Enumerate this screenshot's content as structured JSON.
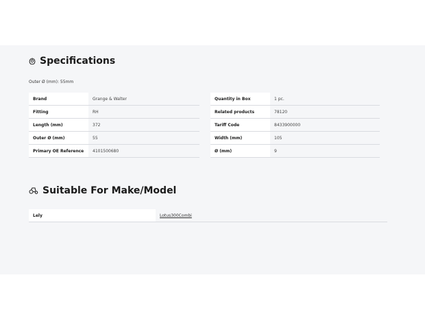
{
  "specifications": {
    "title": "Specifications",
    "subline": "Outer Ø (mm): 55mm",
    "left_rows": [
      {
        "label": "Brand",
        "value": "Grange & Walter"
      },
      {
        "label": "Fitting",
        "value": "RH"
      },
      {
        "label": "Length (mm)",
        "value": "372"
      },
      {
        "label": "Outer Ø (mm)",
        "value": "55"
      },
      {
        "label": "Primary OE Reference",
        "value": "4101500680"
      }
    ],
    "right_rows": [
      {
        "label": "Quantity in Box",
        "value": "1 pc."
      },
      {
        "label": "Related products",
        "value": "78120"
      },
      {
        "label": "Tariff Code",
        "value": "8433900000"
      },
      {
        "label": "Width (mm)",
        "value": "105"
      },
      {
        "label": "Ø (mm)",
        "value": "9"
      }
    ]
  },
  "fitment": {
    "title": "Suitable For Make/Model",
    "rows": [
      {
        "make": "Lely",
        "model": "Lotus300Combi"
      }
    ]
  },
  "icons": {
    "specifications": "gear-icon",
    "fitment": "tractor-icon"
  },
  "colors": {
    "panel_background": "#f5f6f8",
    "row_border": "#d9dbe0"
  }
}
